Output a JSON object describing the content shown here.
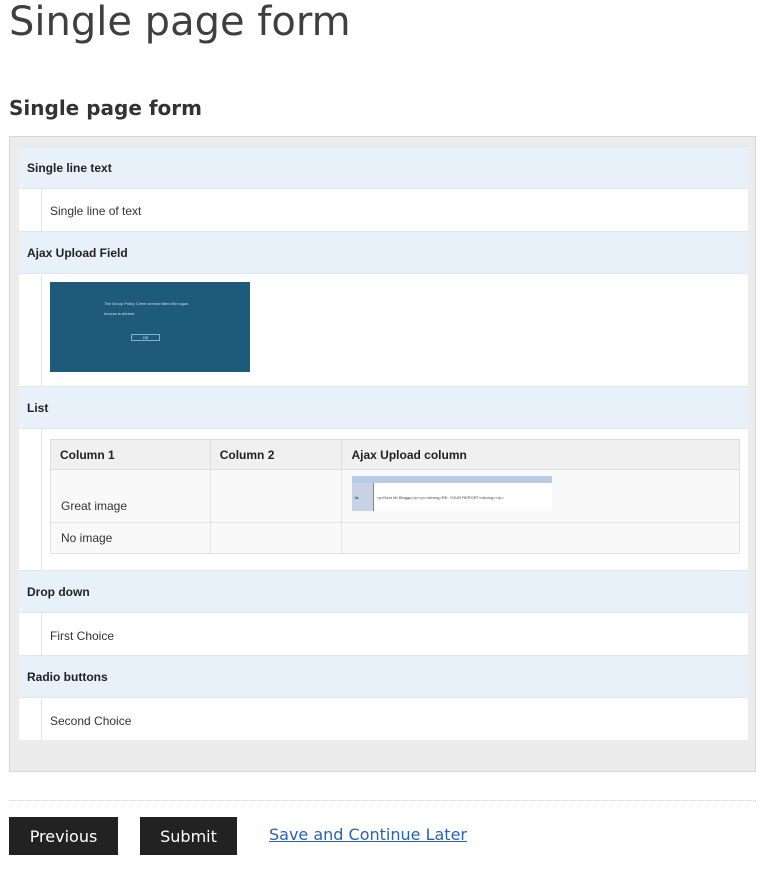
{
  "page": {
    "title": "Single page form",
    "form_title": "Single page form"
  },
  "sections": {
    "single_line": {
      "label": "Single line text",
      "value": "Single line of text"
    },
    "ajax_upload": {
      "label": "Ajax Upload Field",
      "thumb_line1": "The Group Policy Client service failed the logon.",
      "thumb_line2": "Access is denied.",
      "thumb_ok": "OK"
    },
    "list": {
      "label": "List",
      "columns": [
        "Column 1",
        "Column 2",
        "Ajax Upload column"
      ],
      "rows": [
        {
          "col1": "Great image",
          "col2": "",
          "thumb_side": "0▸",
          "thumb_code": "<p>Dear Mr Bloggs</p><p><strong>RE: YOUR REPORT</strong></p>"
        },
        {
          "col1": "No image",
          "col2": "",
          "col3": ""
        }
      ]
    },
    "drop_down": {
      "label": "Drop down",
      "value": "First Choice"
    },
    "radio": {
      "label": "Radio buttons",
      "value": "Second Choice"
    }
  },
  "actions": {
    "previous": "Previous",
    "submit": "Submit",
    "save_later": "Save and Continue Later"
  },
  "colors": {
    "section_header_bg": "#e8f0f9",
    "button_bg": "#222222",
    "link": "#2b62b0",
    "thumb_bg": "#1e5a79"
  }
}
